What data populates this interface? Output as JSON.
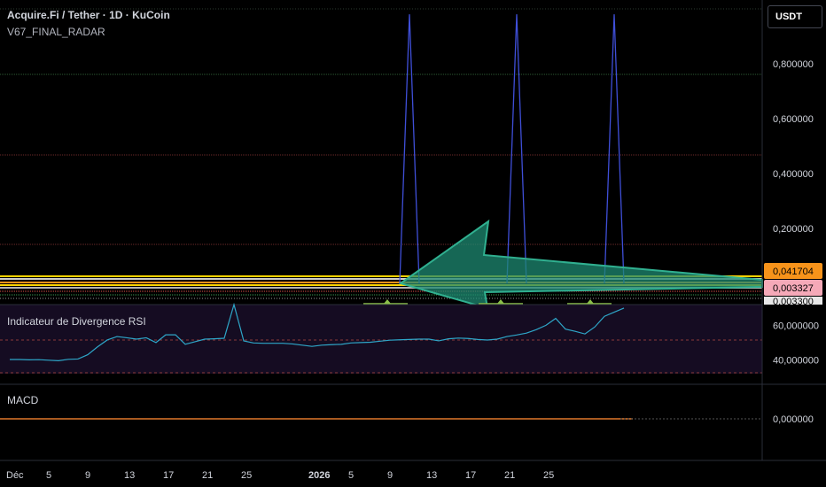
{
  "header": {
    "title": "Acquire.Fi / Tether · 1D · KuCoin",
    "indicator": "V67_FINAL_RADAR",
    "currency_button": "USDT"
  },
  "colors": {
    "background": "#000000",
    "axis_text": "#d1d4dc",
    "spike_line": "#3f4fd8",
    "arrow_fill": "#1e8a72",
    "arrow_stroke": "#30b090",
    "rsi_line": "#2ea6c8",
    "rsi_band": "#150c22",
    "macd_line": "#e0782a",
    "orange_badge": "#f7931a",
    "pink_badge": "#f5a9b8",
    "yellow_line": "#ffd400"
  },
  "chart_data": [
    {
      "type": "line",
      "panel": "main",
      "y_ticks": [
        "0,800000",
        "0,600000",
        "0,400000",
        "0,200000"
      ],
      "ylim": [
        0,
        1
      ],
      "series": [
        {
          "x": [
            40,
            41,
            42,
            51,
            52,
            53,
            61,
            62,
            63
          ],
          "values": [
            0.0,
            0.98,
            0.0,
            0.0,
            0.98,
            0.0,
            0.0,
            0.98,
            0.0
          ]
        }
      ],
      "price_labels": [
        "0,041704",
        "0,003327",
        "0,003300"
      ]
    },
    {
      "type": "line",
      "panel": "rsi",
      "title": "Indicateur de Divergence RSI",
      "y_ticks": [
        "60,000000",
        "40,000000"
      ],
      "ylim": [
        32,
        72
      ],
      "series": [
        {
          "x": [
            0,
            1,
            2,
            3,
            4,
            5,
            6,
            7,
            8,
            9,
            10,
            11,
            12,
            13,
            14,
            15,
            16,
            17,
            18,
            19,
            20,
            21,
            22,
            23,
            24,
            25,
            26,
            27,
            28,
            29,
            30,
            31,
            32,
            33,
            34,
            35,
            36,
            37,
            38,
            39,
            40,
            41,
            42,
            43,
            44,
            45,
            46,
            47,
            48,
            49,
            50,
            51,
            52,
            53,
            54,
            55,
            56,
            57,
            58,
            59,
            60,
            61,
            62,
            63
          ],
          "values": [
            40.2,
            40.2,
            40.0,
            40.1,
            39.8,
            39.5,
            40.3,
            40.5,
            43.0,
            47.5,
            51.5,
            53.5,
            52.8,
            52.0,
            52.8,
            50.0,
            54.5,
            54.5,
            49.0,
            50.5,
            52.0,
            52.2,
            52.5,
            73.0,
            51.0,
            49.8,
            49.6,
            49.6,
            49.6,
            49.2,
            48.5,
            47.8,
            48.5,
            48.8,
            49.0,
            49.8,
            50.0,
            50.2,
            50.8,
            51.4,
            51.6,
            51.8,
            52.0,
            52.0,
            51.0,
            52.2,
            52.6,
            52.4,
            51.8,
            51.5,
            52.0,
            53.5,
            54.4,
            55.5,
            57.5,
            60.0,
            64.0,
            57.8,
            56.5,
            55.0,
            59.0,
            65.2,
            67.6,
            70.0
          ]
        }
      ]
    },
    {
      "type": "line",
      "panel": "macd",
      "title": "MACD",
      "y_ticks": [
        "0,000000"
      ],
      "ylim": [
        -1,
        1
      ],
      "series": [
        {
          "x": [
            0,
            53
          ],
          "values": [
            0.0,
            0.0
          ]
        }
      ]
    }
  ],
  "x_axis": {
    "ticks": [
      {
        "label": "Déc",
        "day": 0,
        "bold": false
      },
      {
        "label": "5",
        "day": 4,
        "bold": false
      },
      {
        "label": "9",
        "day": 8,
        "bold": false
      },
      {
        "label": "13",
        "day": 12,
        "bold": false
      },
      {
        "label": "17",
        "day": 16,
        "bold": false
      },
      {
        "label": "21",
        "day": 20,
        "bold": false
      },
      {
        "label": "25",
        "day": 24,
        "bold": false
      },
      {
        "label": "2026",
        "day": 31,
        "bold": true
      },
      {
        "label": "5",
        "day": 35,
        "bold": false
      },
      {
        "label": "9",
        "day": 39,
        "bold": false
      },
      {
        "label": "13",
        "day": 43,
        "bold": false
      },
      {
        "label": "17",
        "day": 47,
        "bold": false
      },
      {
        "label": "21",
        "day": 51,
        "bold": false
      },
      {
        "label": "25",
        "day": 55,
        "bold": false
      }
    ]
  }
}
